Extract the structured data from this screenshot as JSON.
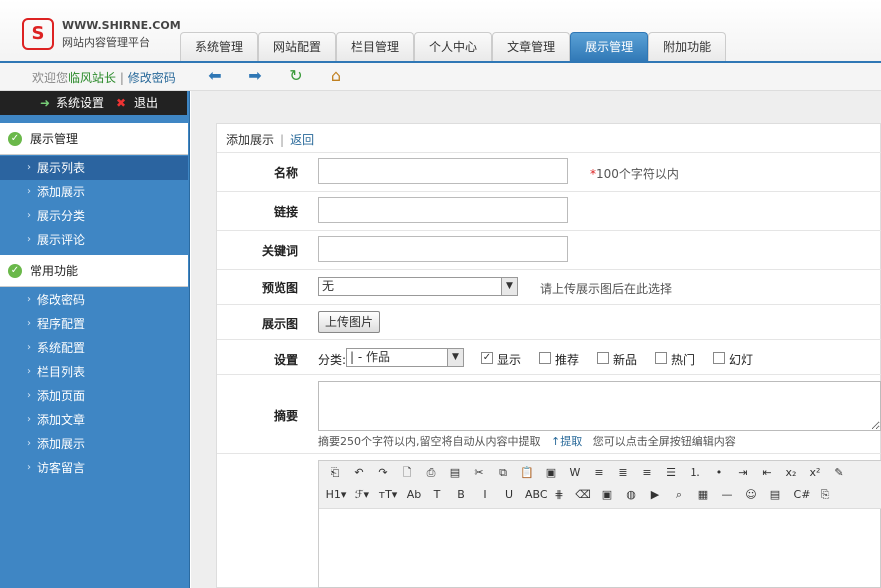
{
  "brand": {
    "logo_text": "S",
    "url": "WWW.SHIRNE.COM",
    "subtitle": "网站内容管理平台"
  },
  "nav": {
    "tabs": [
      "系统管理",
      "网站配置",
      "栏目管理",
      "个人中心",
      "文章管理",
      "展示管理",
      "附加功能"
    ],
    "active": "展示管理"
  },
  "subbar": {
    "welcome": "欢迎您",
    "user": "临风站长",
    "sep": "|",
    "change_pwd": "修改密码"
  },
  "toolbar_icons": [
    "arrow-left-icon",
    "arrow-right-icon",
    "refresh-icon",
    "home-icon"
  ],
  "sysbar": {
    "settings": "系统设置",
    "logout": "退出"
  },
  "sidebar": {
    "sections": [
      {
        "title": "展示管理",
        "items": [
          "展示列表",
          "添加展示",
          "展示分类",
          "展示评论"
        ],
        "selected": "展示列表"
      },
      {
        "title": "常用功能",
        "items": [
          "修改密码",
          "程序配置",
          "系统配置",
          "栏目列表",
          "添加页面",
          "添加文章",
          "添加展示",
          "访客留言"
        ]
      }
    ]
  },
  "panel": {
    "title": "添加展示",
    "sep": "|",
    "back": "返回",
    "fields": {
      "name": {
        "label": "名称",
        "hint_star": "*",
        "hint": "100个字符以内",
        "value": ""
      },
      "link": {
        "label": "链接",
        "value": ""
      },
      "keywords": {
        "label": "关键词",
        "value": ""
      },
      "preview": {
        "label": "预览图",
        "selected": "无",
        "hint": "请上传展示图后在此选择"
      },
      "image": {
        "label": "展示图",
        "button": "上传图片"
      },
      "settings": {
        "label": "设置",
        "category_label": "分类:",
        "category_value": "| - 作品",
        "checks": [
          {
            "label": "显示",
            "checked": true
          },
          {
            "label": "推荐",
            "checked": false
          },
          {
            "label": "新品",
            "checked": false
          },
          {
            "label": "热门",
            "checked": false
          },
          {
            "label": "幻灯",
            "checked": false
          }
        ]
      },
      "summary": {
        "label": "摘要",
        "hint": "摘要250个字符以内,留空将自动从内容中提取",
        "extract": "↑提取",
        "hint2": "您可以点击全屏按钮编辑内容"
      }
    }
  },
  "editor_row1": [
    "source-icon",
    "undo-icon",
    "redo-icon",
    "preview-icon",
    "print-icon",
    "template-icon",
    "cut-icon",
    "copy-icon",
    "paste-icon",
    "paste-plain-icon",
    "paste-word-icon",
    "align-left-icon",
    "align-center-icon",
    "align-right-icon",
    "justify-icon",
    "ordered-list-icon",
    "unordered-list-icon",
    "indent-icon",
    "outdent-icon",
    "subscript-icon",
    "superscript-icon",
    "clear-format-icon"
  ],
  "editor_row2": [
    {
      "name": "heading-icon",
      "text": "H1▾"
    },
    {
      "name": "font-family-icon",
      "text": "ℱ▾"
    },
    {
      "name": "font-size-icon",
      "text": "тT▾"
    },
    {
      "name": "font-color-icon",
      "text": "Ab"
    },
    {
      "name": "highlight-icon",
      "text": "T"
    },
    {
      "name": "bold-icon",
      "text": "B"
    },
    {
      "name": "italic-icon",
      "text": "I"
    },
    {
      "name": "underline-icon",
      "text": "U"
    },
    {
      "name": "strikethrough-icon",
      "text": "ABC"
    },
    {
      "name": "line-height-icon",
      "text": "⋕"
    },
    {
      "name": "remove-format-icon",
      "text": "⌫"
    },
    {
      "name": "image-icon",
      "text": "▣"
    },
    {
      "name": "flash-icon",
      "text": "◍"
    },
    {
      "name": "media-icon",
      "text": "▶"
    },
    {
      "name": "attachment-icon",
      "text": "⌕"
    },
    {
      "name": "table-icon",
      "text": "▦"
    },
    {
      "name": "hr-icon",
      "text": "—"
    },
    {
      "name": "emoticon-icon",
      "text": "☺"
    },
    {
      "name": "map-icon",
      "text": "▤"
    },
    {
      "name": "code-icon",
      "text": "C#"
    },
    {
      "name": "pagebreak-icon",
      "text": "⎘"
    }
  ]
}
